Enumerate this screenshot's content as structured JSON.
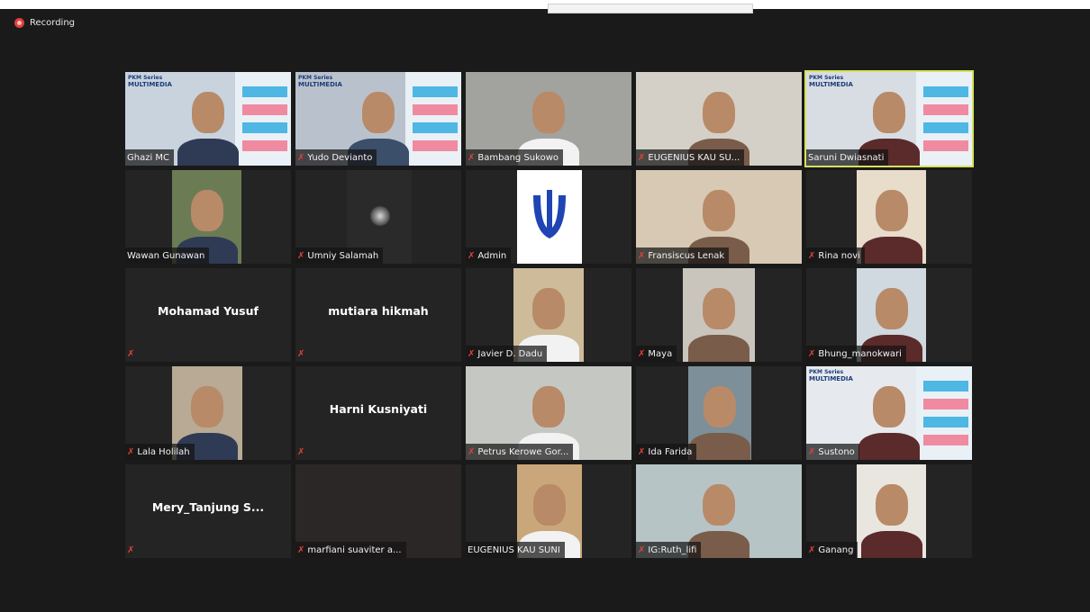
{
  "app": {
    "recording_label": "Recording"
  },
  "participants": [
    {
      "name": "Ghazi MC",
      "muted": false,
      "kind": "video",
      "bg": "#c8d3de"
    },
    {
      "name": "Yudo Devianto",
      "muted": true,
      "kind": "video",
      "bg": "#b9c2cc"
    },
    {
      "name": "Bambang Sukowo",
      "muted": true,
      "kind": "video",
      "bg": "#a2a29e"
    },
    {
      "name": "EUGENIUS KAU SU...",
      "muted": true,
      "kind": "video",
      "bg": "#d4d0c7"
    },
    {
      "name": "Saruni Dwiasnati",
      "muted": false,
      "kind": "video",
      "bg": "#d8dde4",
      "active": true
    },
    {
      "name": "Wawan Gunawan",
      "muted": false,
      "kind": "video",
      "bg": "#6b7c55"
    },
    {
      "name": "Umniy Salamah",
      "muted": true,
      "kind": "video",
      "bg": "#2a2a2a"
    },
    {
      "name": "Admin",
      "muted": true,
      "kind": "logo",
      "bg": "#ffffff"
    },
    {
      "name": "Fransiscus Lenak",
      "muted": true,
      "kind": "video",
      "bg": "#d8c9b4"
    },
    {
      "name": "Rina novi",
      "muted": true,
      "kind": "video",
      "bg": "#e8dccb"
    },
    {
      "name": "Mohamad Yusuf",
      "muted": true,
      "kind": "name"
    },
    {
      "name": "mutiara hikmah",
      "muted": true,
      "kind": "name"
    },
    {
      "name": "Javier D. Dadu",
      "muted": true,
      "kind": "video",
      "bg": "#cdbb9a"
    },
    {
      "name": "Maya",
      "muted": true,
      "kind": "video",
      "bg": "#c9c5bd"
    },
    {
      "name": "Bhung_manokwari",
      "muted": true,
      "kind": "video",
      "bg": "#cfd9df"
    },
    {
      "name": "Lala Holilah",
      "muted": true,
      "kind": "video",
      "bg": "#b8aa94"
    },
    {
      "name": "Harni Kusniyati",
      "muted": true,
      "kind": "name"
    },
    {
      "name": "Petrus Kerowe Gor...",
      "muted": true,
      "kind": "video",
      "bg": "#c5c8c2"
    },
    {
      "name": "Ida Farida",
      "muted": true,
      "kind": "video",
      "bg": "#7d8f98"
    },
    {
      "name": "Sustono",
      "muted": true,
      "kind": "video",
      "bg": "#e6eaee"
    },
    {
      "name": "Mery_Tanjung  S...",
      "muted": true,
      "kind": "name"
    },
    {
      "name": "marfiani suaviter a...",
      "muted": true,
      "kind": "video",
      "bg": "#2b2726"
    },
    {
      "name": "EUGENIUS KAU SUNI",
      "muted": false,
      "kind": "video",
      "bg": "#caa77a"
    },
    {
      "name": "IG:Ruth_lifi",
      "muted": true,
      "kind": "video",
      "bg": "#b7c4c6"
    },
    {
      "name": "Ganang",
      "muted": true,
      "kind": "video",
      "bg": "#e9e6df"
    }
  ],
  "slide": {
    "series": "PKM Series",
    "title": "MULTIMEDIA"
  },
  "colors": {
    "background": "#1b1b1b",
    "tile": "#242424",
    "active_border": "#d6e25a",
    "mute": "#e0403a"
  }
}
